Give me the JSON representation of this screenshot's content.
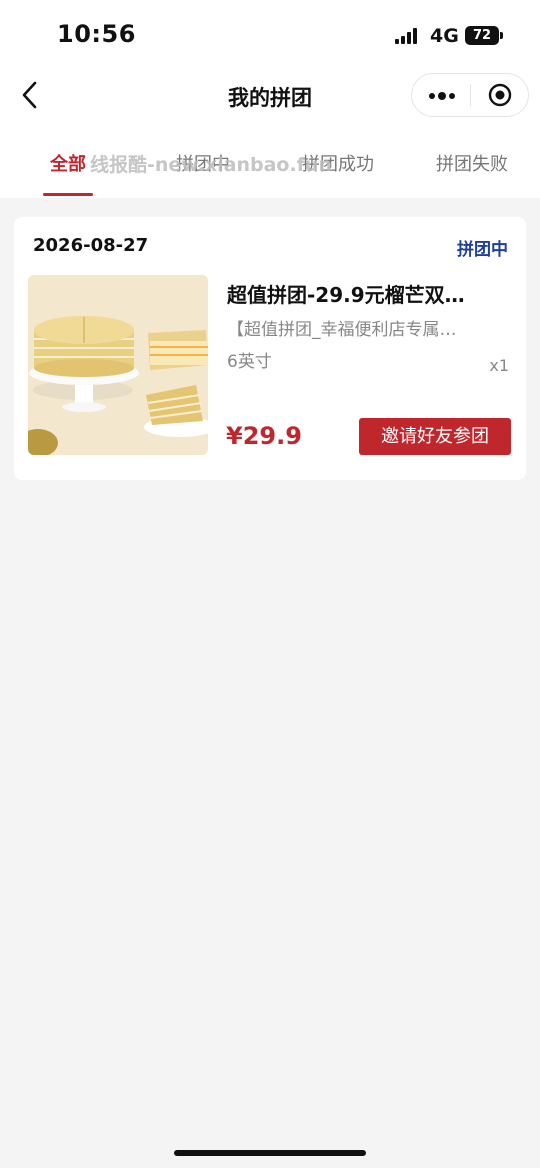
{
  "status_bar": {
    "time": "10:56",
    "network": "4G",
    "battery": "72"
  },
  "nav": {
    "title": "我的拼团"
  },
  "tabs": [
    {
      "label": "全部",
      "active": true
    },
    {
      "label": "拼团中",
      "active": false
    },
    {
      "label": "拼团成功",
      "active": false
    },
    {
      "label": "拼团失败",
      "active": false
    }
  ],
  "watermark": "线报酷-new.xianbao.fun",
  "order": {
    "date": "2026-08-27",
    "status": "拼团中",
    "title": "超值拼团-29.9元榴芒双…",
    "desc": "【超值拼团_幸福便利店专属…",
    "spec": "6英寸",
    "qty": "x1",
    "price": "¥29.9",
    "action": "邀请好友参团"
  },
  "colors": {
    "accent": "#c0272d",
    "status_blue": "#1f3f9a",
    "background": "#f4f4f4"
  },
  "icons": [
    "back-icon",
    "more-icon",
    "target-icon",
    "signal-icon",
    "battery-icon"
  ]
}
